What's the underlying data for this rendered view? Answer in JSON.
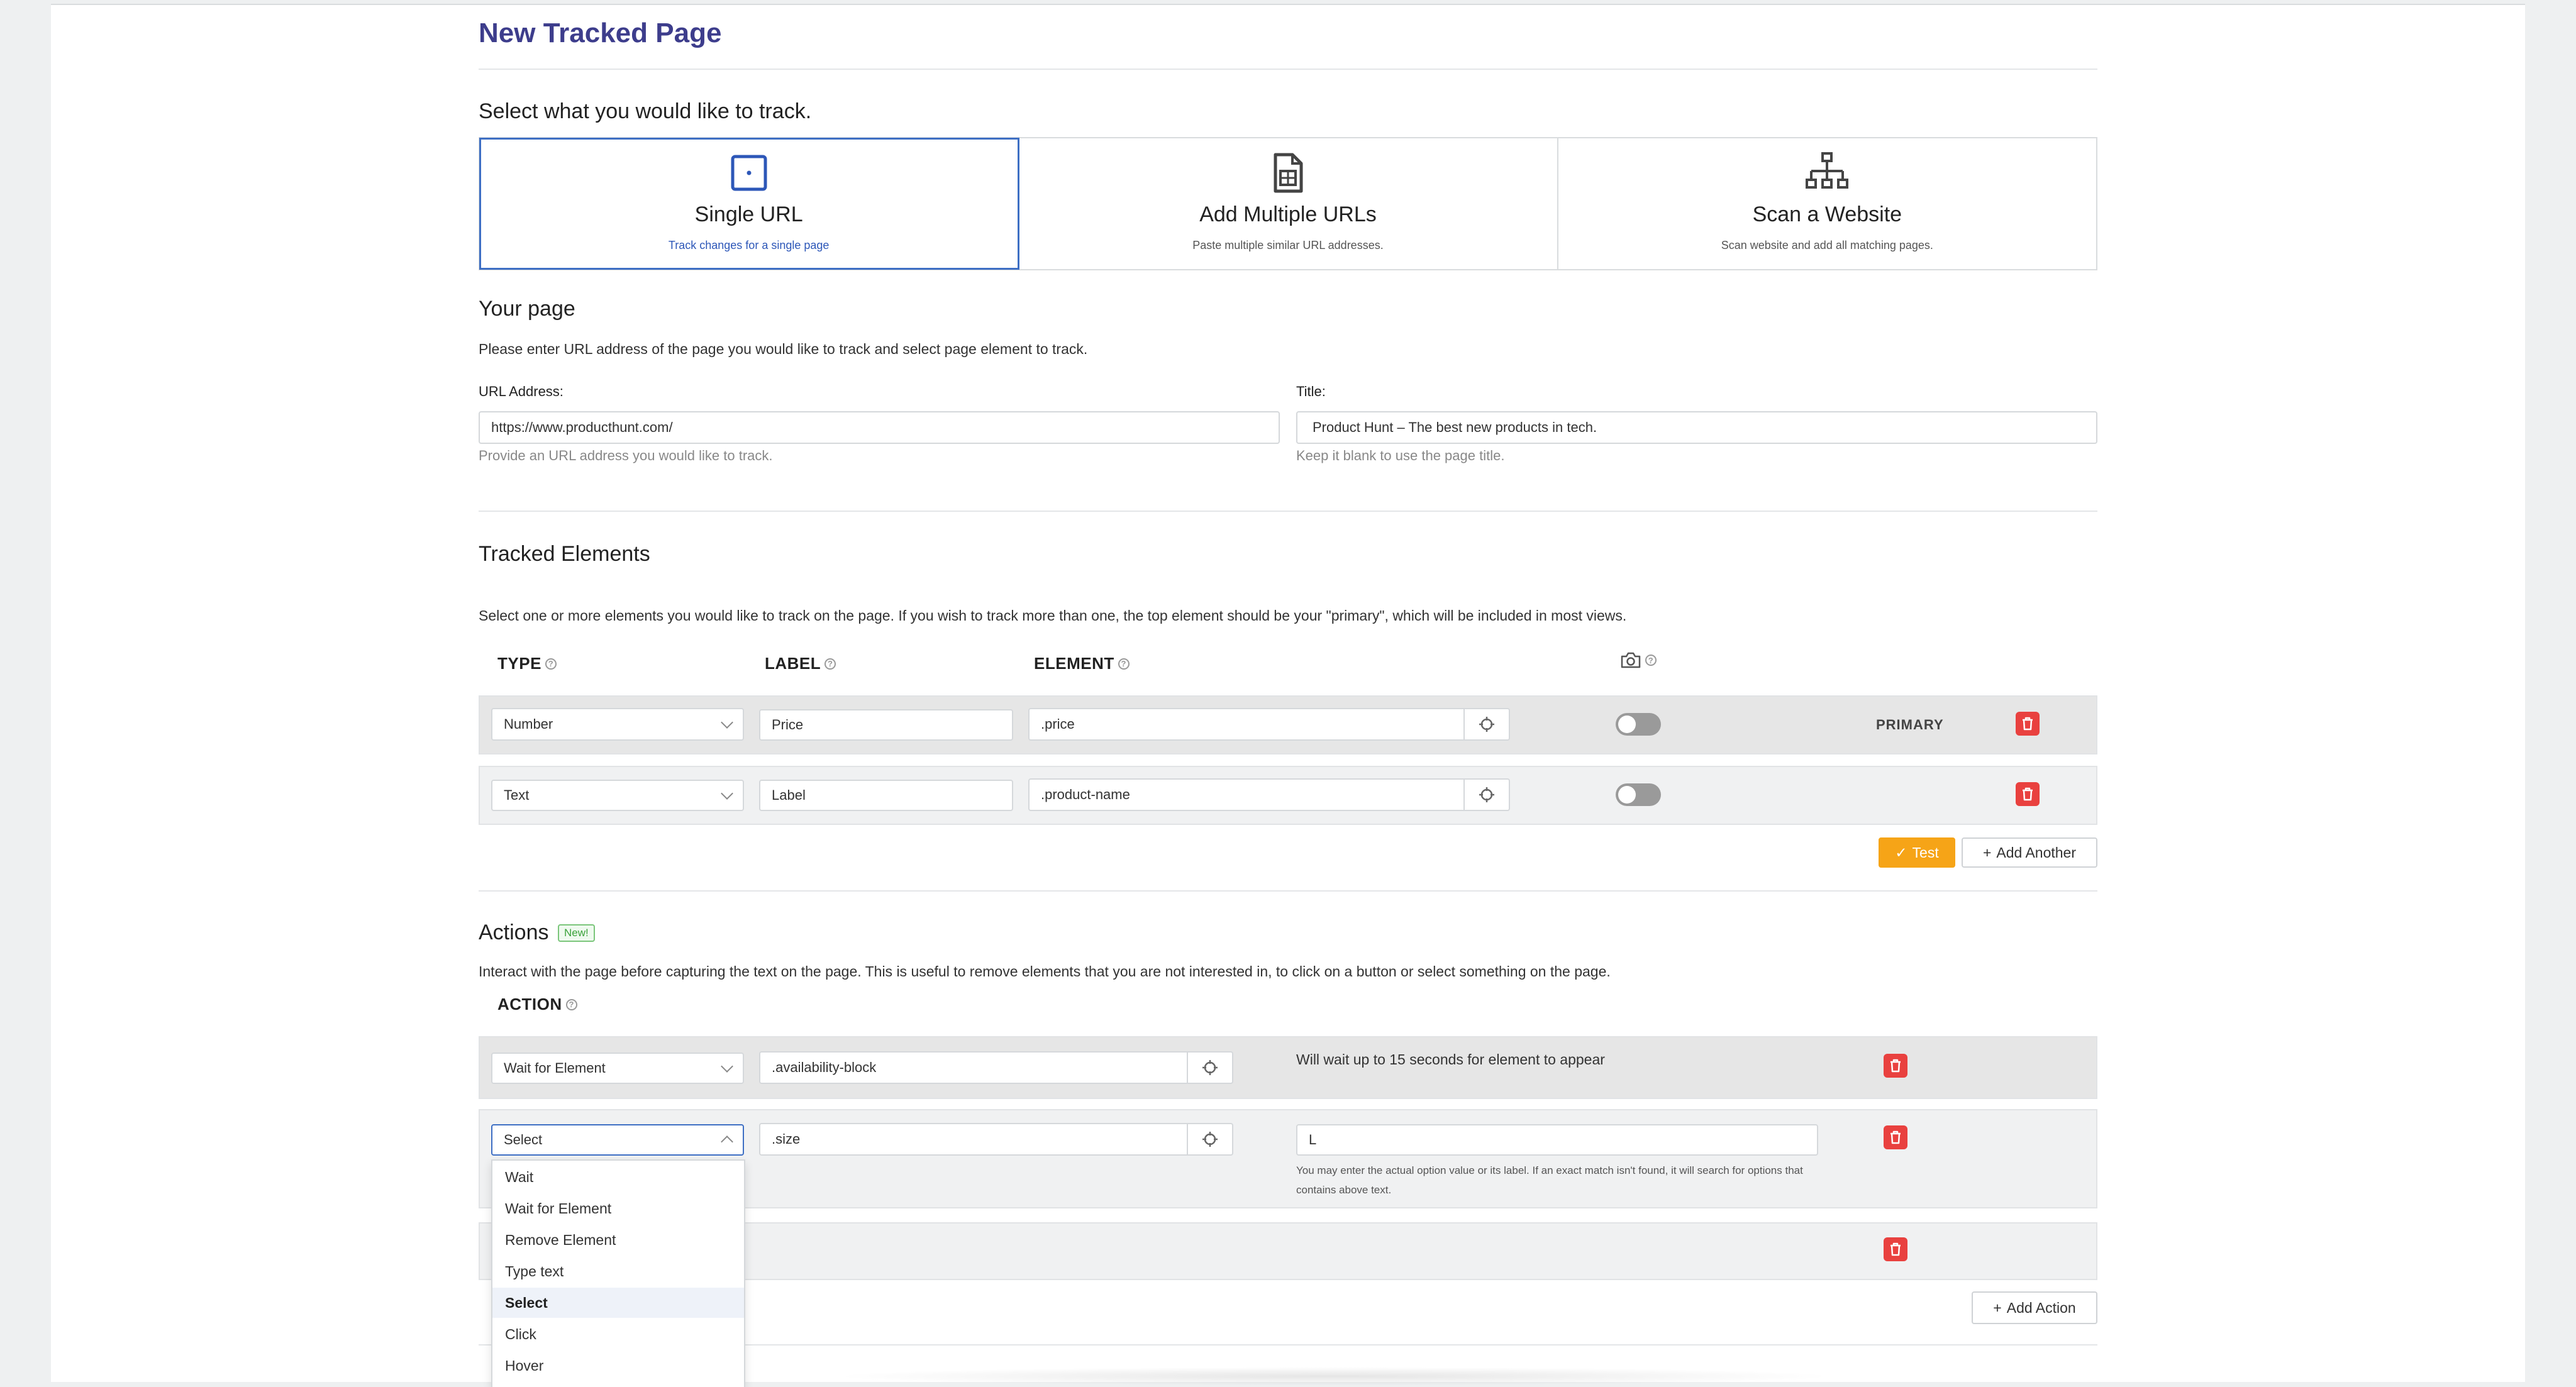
{
  "page_title": "New Tracked Page",
  "select_heading": "Select what you would like to track.",
  "options": [
    {
      "title": "Single URL",
      "subtitle": "Track changes for a single page",
      "icon": "single-url-icon"
    },
    {
      "title": "Add Multiple URLs",
      "subtitle": "Paste multiple similar URL addresses.",
      "icon": "document-table-icon"
    },
    {
      "title": "Scan a Website",
      "subtitle": "Scan website and add all matching pages.",
      "icon": "sitemap-icon"
    }
  ],
  "your_page": {
    "heading": "Your page",
    "description": "Please enter URL address of the page you would like to track and select page element to track.",
    "url_label": "URL Address:",
    "url_value": "https://www.producthunt.com/",
    "url_help": "Provide an URL address you would like to track.",
    "title_label": "Title:",
    "title_value": "Product Hunt – The best new products in tech.",
    "title_help": "Keep it blank to use the page title."
  },
  "tracked_elements": {
    "heading": "Tracked Elements",
    "description": "Select one or more elements you would like to track on the page. If you wish to track more than one, the top element should be your \"primary\", which will be included in most views.",
    "col_type": "TYPE",
    "col_label": "LABEL",
    "col_element": "ELEMENT",
    "rows": [
      {
        "type": "Number",
        "label": "Price",
        "element": ".price",
        "badge": "PRIMARY",
        "screenshot": false
      },
      {
        "type": "Text",
        "label": "Label",
        "element": ".product-name",
        "badge": "",
        "screenshot": false
      }
    ],
    "test_label": "Test",
    "add_another_label": "Add Another"
  },
  "actions": {
    "heading": "Actions",
    "new_badge": "New!",
    "description": "Interact with the page before capturing the text on the page. This is useful to remove elements that you are not interested in, to click on a button or select something on the page.",
    "col_action": "ACTION",
    "rows": [
      {
        "action": "Wait for Element",
        "selector": ".availability-block",
        "note": "Will wait up to 15 seconds for element to appear"
      },
      {
        "action": "Select",
        "selector": ".size",
        "value": "L",
        "help": "You may enter the actual option value or its label. If an exact match isn't found, it will search for options that contains above text."
      }
    ],
    "add_action_label": "Add Action",
    "dropdown_options": [
      "Wait",
      "Wait for Element",
      "Remove Element",
      "Type text",
      "Select",
      "Click",
      "Hover"
    ],
    "dropdown_selected": "Select"
  },
  "colors": {
    "accent": "#3d3d8c",
    "active_border": "#3e6fc4",
    "test_button": "#f6a417",
    "delete": "#e9413f"
  }
}
